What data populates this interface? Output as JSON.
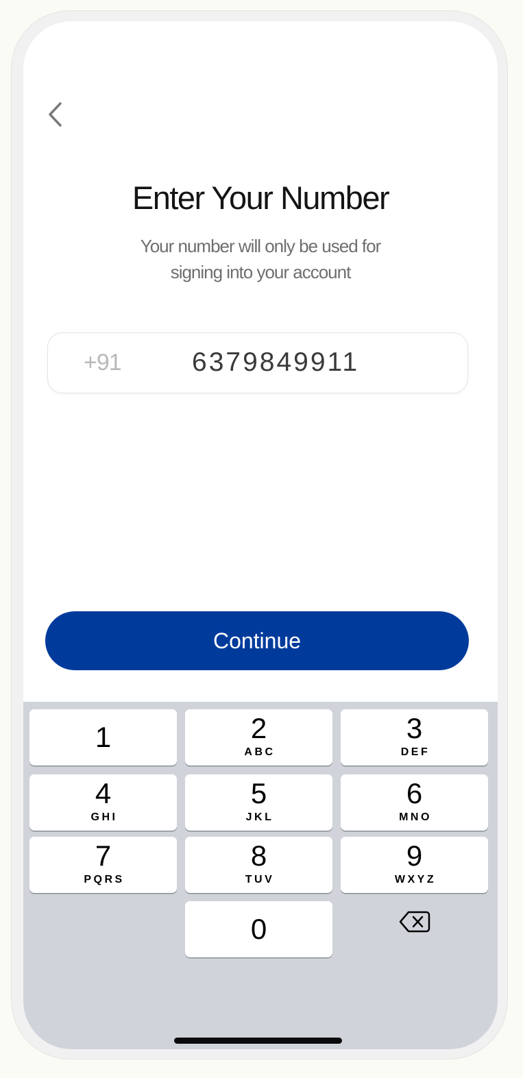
{
  "header": {
    "back_icon": "chevron-left-icon",
    "title": "Enter Your Number",
    "subtitle_line1": "Your number will only be used for",
    "subtitle_line2": "signing into your account"
  },
  "phone_input": {
    "country_code": "+91",
    "value": "6379849911"
  },
  "continue_label": "Continue",
  "keypad": {
    "keys": [
      {
        "digit": "1",
        "letters": ""
      },
      {
        "digit": "2",
        "letters": "ABC"
      },
      {
        "digit": "3",
        "letters": "DEF"
      },
      {
        "digit": "4",
        "letters": "GHI"
      },
      {
        "digit": "5",
        "letters": "JKL"
      },
      {
        "digit": "6",
        "letters": "MNO"
      },
      {
        "digit": "7",
        "letters": "PQRS"
      },
      {
        "digit": "8",
        "letters": "TUV"
      },
      {
        "digit": "9",
        "letters": "WXYZ"
      },
      {
        "digit": "0",
        "letters": ""
      }
    ],
    "delete_icon": "backspace-icon"
  },
  "colors": {
    "primary": "#003b9c",
    "keypad_bg": "#d0d4da"
  }
}
